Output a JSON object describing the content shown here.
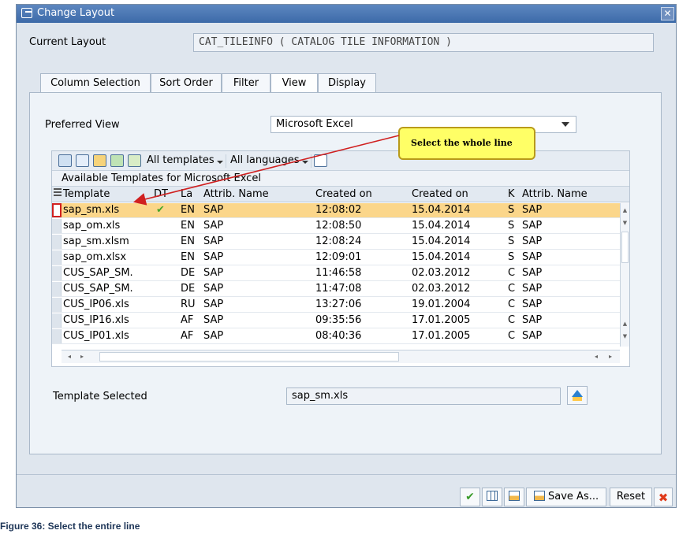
{
  "window": {
    "title": "Change Layout",
    "close_symbol": "✕"
  },
  "current_layout": {
    "label": "Current Layout",
    "value": "CAT_TILEINFO ( CATALOG TILE INFORMATION )"
  },
  "tabs": [
    {
      "label": "Column Selection",
      "active": false
    },
    {
      "label": "Sort Order",
      "active": false
    },
    {
      "label": "Filter",
      "active": false
    },
    {
      "label": "View",
      "active": true
    },
    {
      "label": "Display",
      "active": false
    }
  ],
  "preferred_view": {
    "label": "Preferred View",
    "value": "Microsoft Excel"
  },
  "callout": {
    "text": "Select the whole line"
  },
  "grid": {
    "toolbar": {
      "icons": [
        "find-icon",
        "refresh-icon",
        "import-icon",
        "export-icon",
        "copy-icon"
      ],
      "templates_dropdown": "All templates",
      "languages_dropdown": "All languages"
    },
    "caption": "Available Templates for Microsoft Excel",
    "columns": [
      "Template",
      "DT",
      "La",
      "Attrib. Name",
      "Created on",
      "Created on",
      "K",
      "Attrib. Name"
    ],
    "rows": [
      {
        "template": "sap_sm.xls",
        "dt": "✔",
        "la": "EN",
        "attrib": "SAP",
        "time": "12:08:02",
        "date": "15.04.2014",
        "k": "S",
        "attrib2": "SAP",
        "highlighted": true
      },
      {
        "template": "sap_om.xls",
        "dt": "",
        "la": "EN",
        "attrib": "SAP",
        "time": "12:08:50",
        "date": "15.04.2014",
        "k": "S",
        "attrib2": "SAP",
        "highlighted": false
      },
      {
        "template": "sap_sm.xlsm",
        "dt": "",
        "la": "EN",
        "attrib": "SAP",
        "time": "12:08:24",
        "date": "15.04.2014",
        "k": "S",
        "attrib2": "SAP",
        "highlighted": false
      },
      {
        "template": "sap_om.xlsx",
        "dt": "",
        "la": "EN",
        "attrib": "SAP",
        "time": "12:09:01",
        "date": "15.04.2014",
        "k": "S",
        "attrib2": "SAP",
        "highlighted": false
      },
      {
        "template": "CUS_SAP_SM.",
        "dt": "",
        "la": "DE",
        "attrib": "SAP",
        "time": "11:46:58",
        "date": "02.03.2012",
        "k": "C",
        "attrib2": "SAP",
        "highlighted": false
      },
      {
        "template": "CUS_SAP_SM.",
        "dt": "",
        "la": "DE",
        "attrib": "SAP",
        "time": "11:47:08",
        "date": "02.03.2012",
        "k": "C",
        "attrib2": "SAP",
        "highlighted": false
      },
      {
        "template": "CUS_IP06.xls",
        "dt": "",
        "la": "RU",
        "attrib": "SAP",
        "time": "13:27:06",
        "date": "19.01.2004",
        "k": "C",
        "attrib2": "SAP",
        "highlighted": false
      },
      {
        "template": "CUS_IP16.xls",
        "dt": "",
        "la": "AF",
        "attrib": "SAP",
        "time": "09:35:56",
        "date": "17.01.2005",
        "k": "C",
        "attrib2": "SAP",
        "highlighted": false
      },
      {
        "template": "CUS_IP01.xls",
        "dt": "",
        "la": "AF",
        "attrib": "SAP",
        "time": "08:40:36",
        "date": "17.01.2005",
        "k": "C",
        "attrib2": "SAP",
        "highlighted": false
      }
    ]
  },
  "template_selected": {
    "label": "Template Selected",
    "value": "sap_sm.xls"
  },
  "footer": {
    "save_as_label": "Save As...",
    "reset_label": "Reset"
  },
  "figure_caption": "Figure 36: Select the entire line",
  "colors": {
    "highlight_row": "#fbd68a",
    "callout_bg": "#ffff66",
    "arrow": "#d02020",
    "title_bar": "#3c6aa8"
  }
}
